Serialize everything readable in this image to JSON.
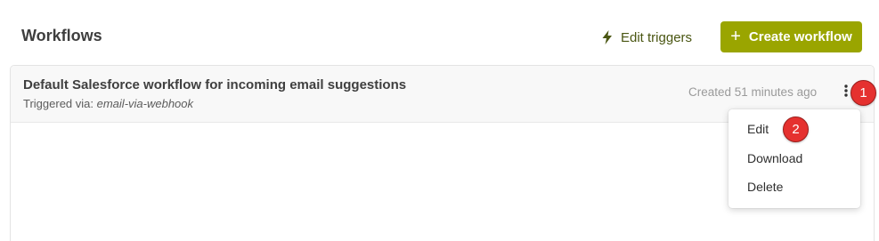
{
  "page": {
    "title": "Workflows"
  },
  "toolbar": {
    "edit_triggers_label": "Edit triggers",
    "edit_triggers_icon": "lightning-bolt-icon",
    "create_workflow_label": "Create workflow",
    "create_workflow_icon": "plus-icon"
  },
  "workflow": {
    "title": "Default Salesforce workflow for incoming email suggestions",
    "triggered_prefix": "Triggered via:",
    "trigger_name": "email-via-webhook",
    "created": "Created 51 minutes ago",
    "more_icon": "vertical-ellipsis-icon"
  },
  "menu": {
    "items": [
      {
        "label": "Edit"
      },
      {
        "label": "Download"
      },
      {
        "label": "Delete"
      }
    ]
  },
  "annotations": {
    "badge_1": "1",
    "badge_2": "2"
  },
  "colors": {
    "accent": "#9aa500",
    "edit_triggers_text": "#4a5612",
    "badge": "#e5312f"
  }
}
